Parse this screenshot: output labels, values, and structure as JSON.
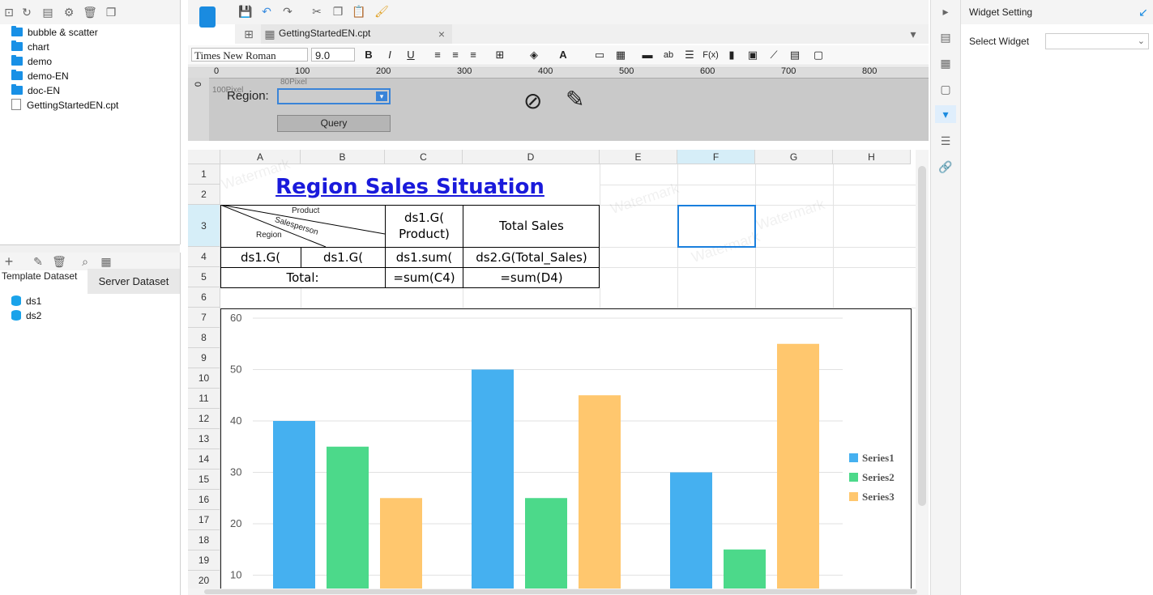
{
  "left_panel": {
    "tree": [
      {
        "label": "bubble & scatter",
        "type": "folder"
      },
      {
        "label": "chart",
        "type": "folder"
      },
      {
        "label": "demo",
        "type": "folder"
      },
      {
        "label": "demo-EN",
        "type": "folder"
      },
      {
        "label": "doc-EN",
        "type": "folder"
      },
      {
        "label": "GettingStartedEN.cpt",
        "type": "file"
      }
    ],
    "dataset": {
      "template_label": "Template Dataset",
      "server_tab": "Server Dataset",
      "items": [
        "ds1",
        "ds2"
      ]
    }
  },
  "file_tab": {
    "label": "GettingStartedEN.cpt"
  },
  "format_bar": {
    "font": "Times New Roman",
    "size": "9.0"
  },
  "param_panel": {
    "ruler_ticks": [
      "0",
      "100",
      "200",
      "300",
      "400",
      "500",
      "600",
      "700",
      "800"
    ],
    "ruler_left": "0",
    "region_label": "Region:",
    "query_label": "Query",
    "px80": "80Pixel",
    "px100": "100Pixel"
  },
  "sheet": {
    "columns": [
      "A",
      "B",
      "C",
      "D",
      "E",
      "F",
      "G",
      "H"
    ],
    "rows": [
      "1",
      "2",
      "3",
      "4",
      "5",
      "6",
      "7",
      "8",
      "9",
      "10",
      "11",
      "12",
      "13",
      "14",
      "15",
      "16",
      "17",
      "18",
      "19",
      "20"
    ],
    "title": "Region Sales Situation",
    "header_product": "Product",
    "header_salesperson": "Salesperson",
    "header_region": "Region",
    "c3": "ds1.G( Product)",
    "d3": "Total Sales",
    "a4": "ds1.G(",
    "b4": "ds1.G(",
    "c4": "ds1.sum(",
    "d4": "ds2.G(Total_Sales)",
    "a5": "Total:",
    "c5": "=sum(C4)",
    "d5": "=sum(D4)",
    "watermark": "Watermark"
  },
  "chart_data": {
    "type": "bar",
    "title": "",
    "categories": [
      "",
      "",
      ""
    ],
    "series": [
      {
        "name": "Series1",
        "values": [
          40,
          50,
          30
        ],
        "color": "#45b0f0"
      },
      {
        "name": "Series2",
        "values": [
          35,
          25,
          15
        ],
        "color": "#4cd98a"
      },
      {
        "name": "Series3",
        "values": [
          25,
          45,
          55
        ],
        "color": "#ffc76e"
      }
    ],
    "yticks": [
      "60",
      "50",
      "40",
      "30",
      "20",
      "10"
    ],
    "ylim": [
      0,
      60
    ],
    "legend": "right"
  },
  "right_panel": {
    "title": "Widget Setting",
    "select_label": "Select Widget"
  }
}
